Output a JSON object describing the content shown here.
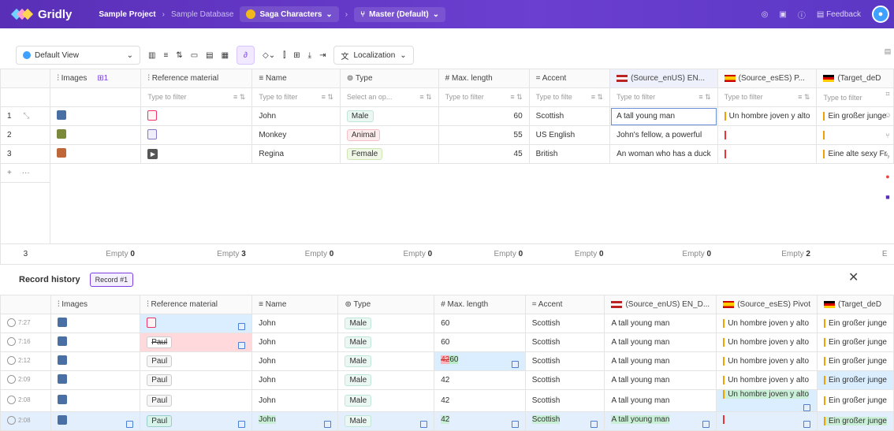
{
  "app": {
    "name": "Gridly"
  },
  "breadcrumb": {
    "project": "Sample Project",
    "database": "Sample Database",
    "grid": "Saga Characters",
    "branch": "Master (Default)"
  },
  "topbar": {
    "feedback": "Feedback"
  },
  "toolbar": {
    "view": "Default View",
    "localization": "Localization"
  },
  "columns": {
    "images": "Images",
    "images_badge": "1",
    "reference": "Reference material",
    "name": "Name",
    "type": "Type",
    "maxlength": "Max. length",
    "accent": "Accent",
    "en": "(Source_enUS)  EN...",
    "es": "(Source_esES)  P...",
    "de": "(Target_deD"
  },
  "filters": {
    "typeto": "Type to filter",
    "select": "Select an op...",
    "typetofilte": "Type to filte"
  },
  "rows": [
    {
      "num": "1",
      "name": "John",
      "type": "Male",
      "max": "60",
      "accent": "Scottish",
      "en": "A tall young man",
      "es": "Un hombre joven y alto",
      "de": "Ein großer junge"
    },
    {
      "num": "2",
      "name": "Monkey",
      "type": "Animal",
      "max": "55",
      "accent": "US English",
      "en": "John's fellow, a powerful",
      "es": "",
      "de": ""
    },
    {
      "num": "3",
      "name": "Regina",
      "type": "Female",
      "max": "45",
      "accent": "British",
      "en": "An woman who has a duck",
      "es": "",
      "de": "Eine alte sexy Fr"
    }
  ],
  "add_row": "+",
  "footer": {
    "count": "3",
    "empty_label": "Empty",
    "images": "0",
    "reference": "3",
    "name": "0",
    "type": "0",
    "max": "0",
    "accent": "0",
    "en": "0",
    "es": "2",
    "de_trunc": "E"
  },
  "history": {
    "title": "Record history",
    "record": "Record #1",
    "columns": {
      "images": "Images",
      "reference": "Reference material",
      "name": "Name",
      "type": "Type",
      "maxlength": "Max. length",
      "accent": "Accent",
      "en": "(Source_enUS)  EN_D...",
      "es": "(Source_esES)  Pivot",
      "de": "(Target_deD"
    },
    "rows": [
      {
        "time": "7:27",
        "ref": "",
        "name": "John",
        "type": "Male",
        "max": "60",
        "accent": "Scottish",
        "en": "A tall young man",
        "es": "Un hombre joven y alto",
        "de": "Ein großer junge"
      },
      {
        "time": "7:16",
        "ref": "Paul",
        "name": "John",
        "type": "Male",
        "max": "60",
        "accent": "Scottish",
        "en": "A tall young man",
        "es": "Un hombre joven y alto",
        "de": "Ein großer junge"
      },
      {
        "time": "2:12",
        "ref": "Paul",
        "name": "John",
        "type": "Male",
        "max_old": "42",
        "max": "60",
        "accent": "Scottish",
        "en": "A tall young man",
        "es": "Un hombre joven y alto",
        "de": "Ein großer junge"
      },
      {
        "time": "2:09",
        "ref": "Paul",
        "name": "John",
        "type": "Male",
        "max": "42",
        "accent": "Scottish",
        "en": "A tall young man",
        "es": "Un hombre joven y alto",
        "de": "Ein großer junge"
      },
      {
        "time": "2:08",
        "ref": "Paul",
        "name": "John",
        "type": "Male",
        "max": "42",
        "accent": "Scottish",
        "en": "A tall young man",
        "es": "Un hombre joven y alto",
        "de": "Ein großer junge"
      },
      {
        "time": "2:08",
        "ref": "Paul",
        "name": "John",
        "type": "Male",
        "max": "42",
        "accent": "Scottish",
        "en": "A tall young man",
        "es": "",
        "de": "Ein großer junge"
      }
    ]
  },
  "colors": {
    "brand": "#6b3fd0",
    "accent": "#7b3fe4"
  }
}
